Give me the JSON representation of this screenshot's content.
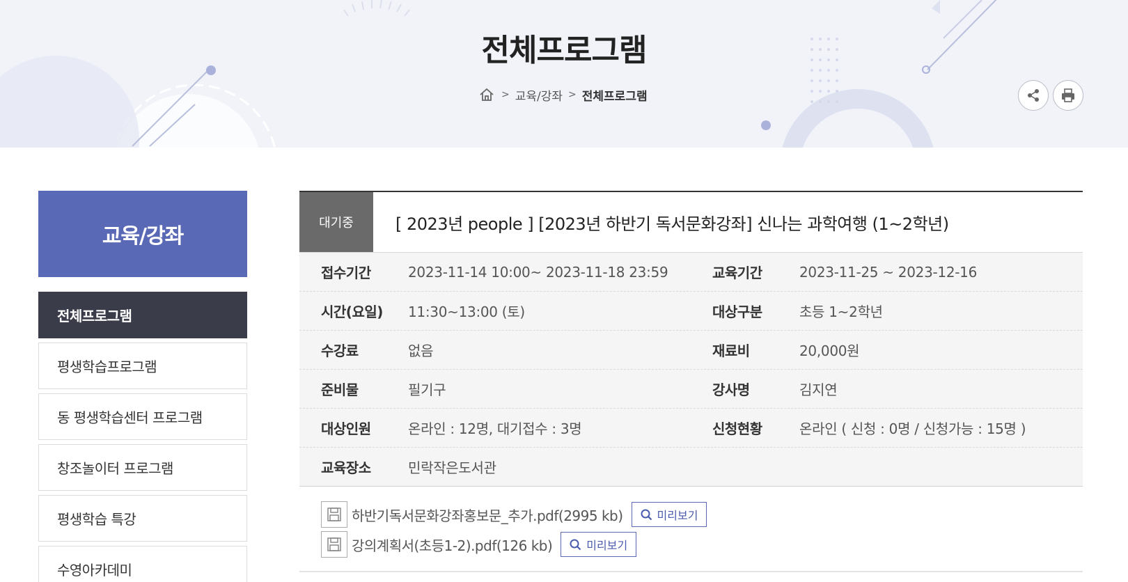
{
  "header": {
    "page_title": "전체프로그램",
    "breadcrumb": [
      "교육/강좌",
      "전체프로그램"
    ],
    "share_icon": "share-icon",
    "print_icon": "print-icon"
  },
  "sidebar": {
    "title": "교육/강좌",
    "items": [
      {
        "label": "전체프로그램",
        "active": true
      },
      {
        "label": "평생학습프로그램",
        "active": false
      },
      {
        "label": "동 평생학습센터 프로그램",
        "active": false
      },
      {
        "label": "창조놀이터 프로그램",
        "active": false
      },
      {
        "label": "평생학습 특강",
        "active": false
      },
      {
        "label": "수영아카데미",
        "active": false
      }
    ]
  },
  "program": {
    "status": "대기중",
    "title": "[ 2023년 people ] [2023년 하반기 독서문화강좌] 신나는 과학여행 (1~2학년)",
    "rows": [
      [
        {
          "label": "접수기간",
          "value": "2023-11-14  10:00~ 2023-11-18  23:59"
        },
        {
          "label": "교육기간",
          "value": "2023-11-25 ~ 2023-12-16"
        }
      ],
      [
        {
          "label": "시간(요일)",
          "value": "11:30~13:00 (토)"
        },
        {
          "label": "대상구분",
          "value": "초등 1~2학년"
        }
      ],
      [
        {
          "label": "수강료",
          "value": "없음"
        },
        {
          "label": "재료비",
          "value": "20,000원"
        }
      ],
      [
        {
          "label": "준비물",
          "value": "필기구"
        },
        {
          "label": "강사명",
          "value": "김지연"
        }
      ],
      [
        {
          "label": "대상인원",
          "value": "온라인 : 12명, 대기접수 : 3명"
        },
        {
          "label": "신청현황",
          "value": "온라인 ( 신청 : 0명 / 신청가능 : 15명 )"
        }
      ],
      [
        {
          "label": "교육장소",
          "value": "민락작은도서관"
        }
      ]
    ],
    "files": [
      {
        "name": "하반기독서문화강좌홍보문_추가.pdf(2995 kb)",
        "preview_label": "미리보기"
      },
      {
        "name": "강의계획서(초등1-2).pdf(126 kb)",
        "preview_label": "미리보기"
      }
    ]
  },
  "colors": {
    "accent": "#5a69b5",
    "active_nav": "#3b3c4a",
    "badge": "#6a6a6a",
    "banner_bg": "#f1f3f9"
  }
}
